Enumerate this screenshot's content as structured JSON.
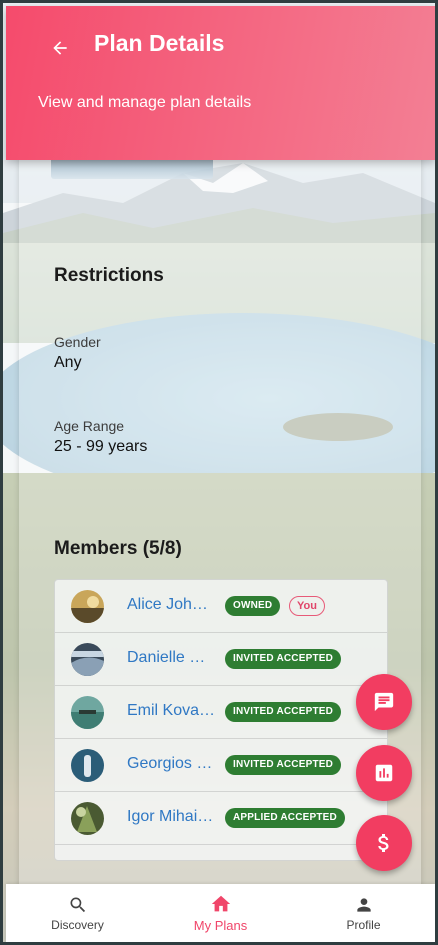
{
  "header": {
    "title": "Plan Details",
    "subtitle": "View and manage plan details"
  },
  "restrictions": {
    "title": "Restrictions",
    "gender_label": "Gender",
    "gender_value": "Any",
    "age_label": "Age Range",
    "age_value": "25 - 99 years"
  },
  "members": {
    "title": "Members (5/8)",
    "items": [
      {
        "name": "Alice Joh…",
        "status": "OWNED",
        "you": "You"
      },
      {
        "name": "Danielle …",
        "status": "INVITED ACCEPTED"
      },
      {
        "name": "Emil Kova…",
        "status": "INVITED ACCEPTED"
      },
      {
        "name": "Georgios …",
        "status": "INVITED ACCEPTED"
      },
      {
        "name": "Igor Mihai…",
        "status": "APPLIED ACCEPTED"
      }
    ]
  },
  "nav": {
    "items": [
      {
        "label": "Discovery",
        "icon": "search-icon"
      },
      {
        "label": "My Plans",
        "icon": "home-icon",
        "active": true
      },
      {
        "label": "Profile",
        "icon": "person-icon"
      }
    ]
  },
  "fabs": [
    "chat-icon",
    "chart-icon",
    "dollar-icon"
  ],
  "colors": {
    "accent": "#f23d61",
    "badge_green": "#2e7d32",
    "link": "#2f78c4"
  }
}
